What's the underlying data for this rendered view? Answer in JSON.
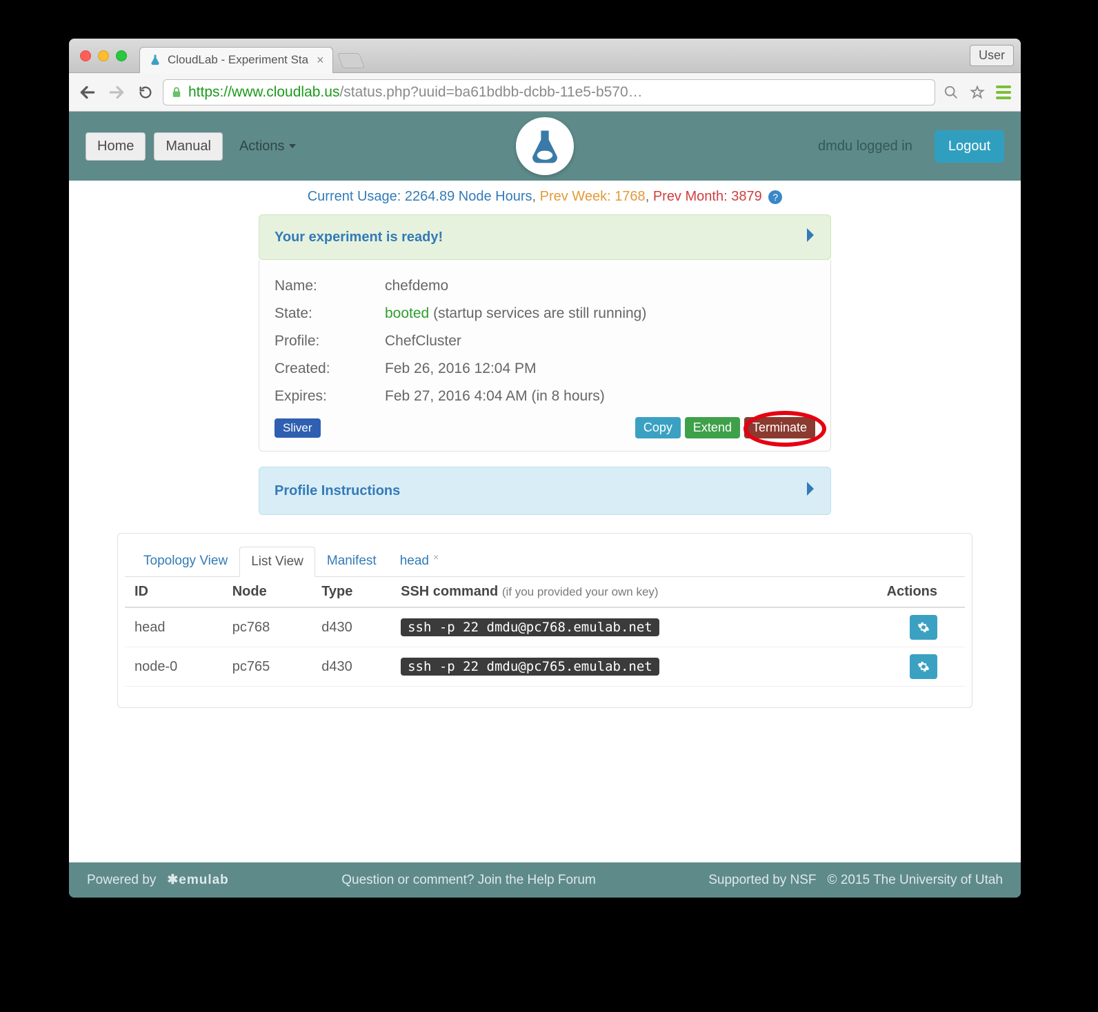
{
  "browser": {
    "tab_title": "CloudLab - Experiment Sta",
    "user_badge": "User",
    "url_proto": "https",
    "url_host": "://www.cloudlab.us",
    "url_path": "/status.php?uuid=ba61bdbb-dcbb-11e5-b570…"
  },
  "nav": {
    "home": "Home",
    "manual": "Manual",
    "actions": "Actions",
    "logged_in": "dmdu logged in",
    "logout": "Logout"
  },
  "usage": {
    "current_label": "Current Usage:",
    "current_value": "2264.89 Node Hours",
    "prev_week_label": "Prev Week:",
    "prev_week_value": "1768",
    "prev_month_label": "Prev Month:",
    "prev_month_value": "3879"
  },
  "panels": {
    "ready": "Your experiment is ready!",
    "instructions": "Profile Instructions"
  },
  "experiment": {
    "name_label": "Name:",
    "name_value": "chefdemo",
    "state_label": "State:",
    "state_value": "booted",
    "state_note": "(startup services are still running)",
    "profile_label": "Profile:",
    "profile_value": "ChefCluster",
    "created_label": "Created:",
    "created_value": "Feb 26, 2016 12:04 PM",
    "expires_label": "Expires:",
    "expires_value": "Feb 27, 2016 4:04 AM (in 8 hours)",
    "sliver": "Sliver",
    "copy": "Copy",
    "extend": "Extend",
    "terminate": "Terminate"
  },
  "tabs": {
    "topology": "Topology View",
    "list": "List View",
    "manifest": "Manifest",
    "head": "head"
  },
  "table": {
    "id": "ID",
    "node": "Node",
    "type": "Type",
    "ssh": "SSH command",
    "ssh_sub": "(if you provided your own key)",
    "actions": "Actions",
    "rows": [
      {
        "id": "head",
        "node": "pc768",
        "type": "d430",
        "ssh": "ssh -p 22 dmdu@pc768.emulab.net"
      },
      {
        "id": "node-0",
        "node": "pc765",
        "type": "d430",
        "ssh": "ssh -p 22 dmdu@pc765.emulab.net"
      }
    ]
  },
  "footer": {
    "powered": "Powered by",
    "emulab": "✱emulab",
    "forum": "Question or comment? Join the Help Forum",
    "nsf": "Supported by NSF",
    "copy": "© 2015 The University of Utah"
  }
}
